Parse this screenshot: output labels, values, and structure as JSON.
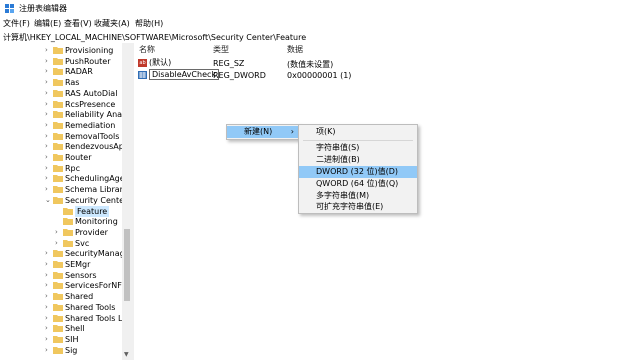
{
  "window": {
    "title": "注册表编辑器",
    "icon": "regedit-icon"
  },
  "menu": [
    "文件(F)",
    "编辑(E)",
    "查看(V)",
    "收藏夹(A)",
    "帮助(H)"
  ],
  "address": "计算机\\HKEY_LOCAL_MACHINE\\SOFTWARE\\Microsoft\\Security Center\\Feature",
  "tree": [
    {
      "label": "Provisioning"
    },
    {
      "label": "PushRouter"
    },
    {
      "label": "RADAR"
    },
    {
      "label": "Ras"
    },
    {
      "label": "RAS AutoDial"
    },
    {
      "label": "RcsPresence"
    },
    {
      "label": "Reliability Analy"
    },
    {
      "label": "Remediation"
    },
    {
      "label": "RemovalTools"
    },
    {
      "label": "RendezvousApp"
    },
    {
      "label": "Router"
    },
    {
      "label": "Rpc"
    },
    {
      "label": "SchedulingAger"
    },
    {
      "label": "Schema Library"
    },
    {
      "label": "Security Center"
    },
    {
      "label": "Feature"
    },
    {
      "label": "Monitoring"
    },
    {
      "label": "Provider"
    },
    {
      "label": "Svc"
    },
    {
      "label": "SecurityManage"
    },
    {
      "label": "SEMgr"
    },
    {
      "label": "Sensors"
    },
    {
      "label": "ServicesForNFS"
    },
    {
      "label": "Shared"
    },
    {
      "label": "Shared Tools"
    },
    {
      "label": "Shared Tools Lo"
    },
    {
      "label": "Shell"
    },
    {
      "label": "SIH"
    },
    {
      "label": "Sig"
    }
  ],
  "columns": {
    "name": "名称",
    "type": "类型",
    "data": "数据"
  },
  "values": [
    {
      "name": "(默认)",
      "type": "REG_SZ",
      "data": "(数值未设置)",
      "icon": "ab"
    },
    {
      "name": "DisableAvCheck",
      "type": "REG_DWORD",
      "data": "0x00000001 (1)",
      "icon": "dword"
    }
  ],
  "context_menu": {
    "new_label": "新建(N)",
    "arrow": "›"
  },
  "submenu": {
    "key": "项(K)",
    "items": [
      "字符串值(S)",
      "二进制值(B)",
      "DWORD (32 位)值(D)",
      "QWORD (64 位)值(Q)",
      "多字符串值(M)",
      "可扩充字符串值(E)"
    ]
  },
  "colors": {
    "selection": "#cce8ff",
    "menu_highlight": "#91c9f7",
    "folder": "#f0c75e"
  }
}
